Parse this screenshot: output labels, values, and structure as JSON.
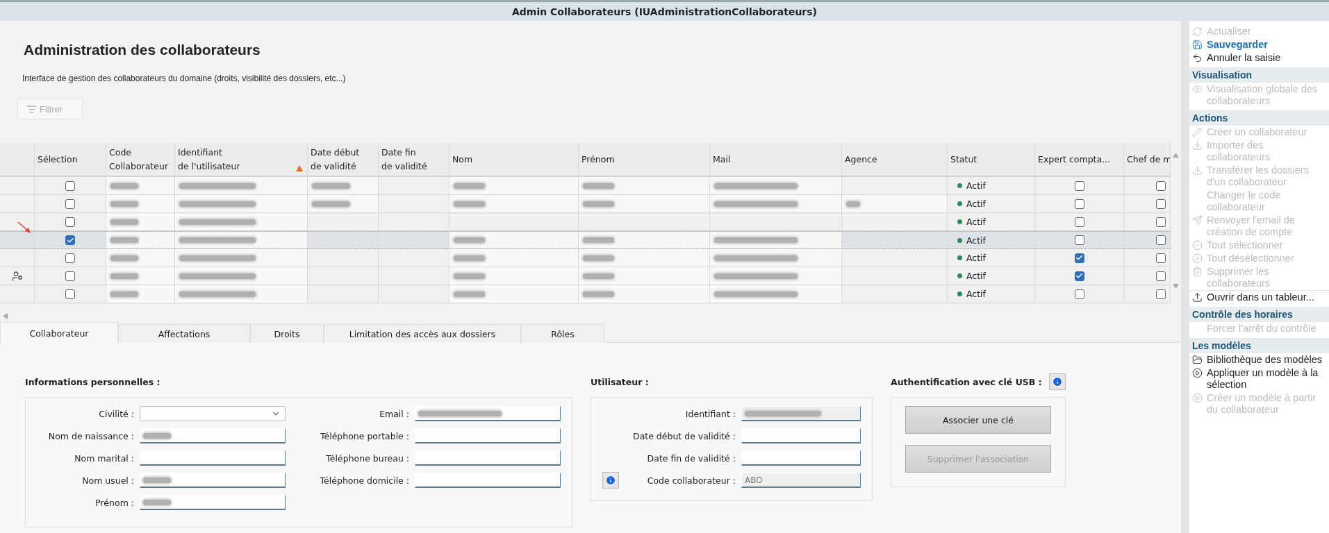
{
  "window": {
    "title": "Admin Collaborateurs (IUAdministrationCollaborateurs)"
  },
  "page": {
    "title": "Administration des collaborateurs",
    "subtitle": "Interface de gestion des collaborateurs du domaine (droits, visibilité des dossiers, etc...)",
    "filter_button": "Filtrer"
  },
  "table": {
    "columns": [
      {
        "kind": "rowhead",
        "sorted": false
      },
      {
        "lines": [
          "Sélection"
        ],
        "kind": "check",
        "sorted": false
      },
      {
        "lines": [
          "Code",
          "Collaborateur"
        ],
        "kind": "text",
        "sorted": false
      },
      {
        "lines": [
          "Identifiant",
          "de l'utilisateur"
        ],
        "kind": "text",
        "sorted": true
      },
      {
        "lines": [
          "Date début",
          "de validité"
        ],
        "kind": "text",
        "sorted": false
      },
      {
        "lines": [
          "Date fin",
          "de validité"
        ],
        "kind": "text",
        "sorted": false
      },
      {
        "lines": [
          "Nom"
        ],
        "kind": "text",
        "sorted": false
      },
      {
        "lines": [
          "Prénom"
        ],
        "kind": "text",
        "sorted": false
      },
      {
        "lines": [
          "Mail"
        ],
        "kind": "text",
        "sorted": false
      },
      {
        "lines": [
          "Agence"
        ],
        "kind": "text",
        "sorted": false
      },
      {
        "lines": [
          "Statut"
        ],
        "kind": "status",
        "sorted": false
      },
      {
        "lines": [
          "Expert compta..."
        ],
        "kind": "check",
        "sorted": false
      },
      {
        "lines": [
          "Chef de m"
        ],
        "kind": "check",
        "sorted": false
      }
    ],
    "rows": [
      {
        "selected": false,
        "user_icon": false,
        "checks": [
          false,
          false,
          false
        ],
        "redacted": [
          true,
          true,
          true,
          false,
          true,
          true,
          true,
          false
        ],
        "status": "Actif"
      },
      {
        "selected": false,
        "user_icon": false,
        "checks": [
          false,
          false,
          false
        ],
        "redacted": [
          true,
          true,
          true,
          false,
          true,
          true,
          true,
          true
        ],
        "status": "Actif"
      },
      {
        "selected": false,
        "user_icon": false,
        "checks": [
          false,
          false,
          false
        ],
        "redacted": [
          true,
          true,
          false,
          false,
          false,
          false,
          false,
          false
        ],
        "status": "Actif"
      },
      {
        "selected": true,
        "user_icon": false,
        "checks": [
          true,
          false,
          false
        ],
        "redacted": [
          true,
          true,
          false,
          false,
          true,
          true,
          true,
          false
        ],
        "status": "Actif"
      },
      {
        "selected": false,
        "user_icon": false,
        "checks": [
          false,
          true,
          false
        ],
        "redacted": [
          true,
          true,
          false,
          false,
          true,
          true,
          true,
          false
        ],
        "status": "Actif"
      },
      {
        "selected": false,
        "user_icon": true,
        "checks": [
          false,
          true,
          false
        ],
        "redacted": [
          true,
          true,
          false,
          false,
          true,
          true,
          true,
          false
        ],
        "status": "Actif"
      },
      {
        "selected": false,
        "user_icon": false,
        "checks": [
          false,
          false,
          false
        ],
        "redacted": [
          true,
          true,
          false,
          false,
          true,
          true,
          true,
          false
        ],
        "status": "Actif"
      }
    ]
  },
  "tabs": [
    {
      "label": "Collaborateur",
      "selected": true
    },
    {
      "label": "Affectations",
      "selected": false
    },
    {
      "label": "Droits",
      "selected": false
    },
    {
      "label": "Limitation des accès aux dossiers",
      "selected": false
    },
    {
      "label": "Rôles",
      "selected": false
    }
  ],
  "personal": {
    "title": "Informations personnelles :",
    "left": [
      {
        "label": "Civilité :",
        "kind": "select",
        "redacted": false
      },
      {
        "label": "Nom de naissance :",
        "kind": "input",
        "redacted": true
      },
      {
        "label": "Nom marital :",
        "kind": "input",
        "redacted": false
      },
      {
        "label": "Nom usuel :",
        "kind": "input",
        "redacted": true
      },
      {
        "label": "Prénom :",
        "kind": "input",
        "redacted": true
      }
    ],
    "right": [
      {
        "label": "Email :",
        "kind": "input",
        "redacted": true
      },
      {
        "label": "Téléphone portable :",
        "kind": "input",
        "redacted": false
      },
      {
        "label": "Téléphone bureau :",
        "kind": "input",
        "redacted": false
      },
      {
        "label": "Téléphone domicile :",
        "kind": "input",
        "redacted": false
      }
    ]
  },
  "user": {
    "title": "Utilisateur :",
    "fields": [
      {
        "label": "Identifiant :",
        "readonly": true,
        "redacted": true,
        "info": false
      },
      {
        "label": "Date début de validité :",
        "readonly": false,
        "redacted": false,
        "info": false
      },
      {
        "label": "Date fin de validité :",
        "readonly": false,
        "redacted": false,
        "info": false
      },
      {
        "label": "Code collaborateur :",
        "readonly": true,
        "redacted": false,
        "value": "ABO",
        "info": true
      }
    ]
  },
  "usb": {
    "title": "Authentification avec clé USB :",
    "buttons": [
      {
        "label": "Associer une clé",
        "disabled": false
      },
      {
        "label": "Supprimer l'association",
        "disabled": true
      }
    ]
  },
  "side_panel": {
    "sections": [
      {
        "items": [
          {
            "label": "Actualiser",
            "disabled": true,
            "primary": false
          },
          {
            "label": "Sauvegarder",
            "disabled": false,
            "primary": true
          },
          {
            "label": "Annuler la saisie",
            "disabled": false,
            "primary": false
          }
        ]
      },
      {
        "title": "Visualisation",
        "items": [
          {
            "label": "Visualisation globale des collaborateurs",
            "disabled": true,
            "primary": false
          }
        ]
      },
      {
        "title": "Actions",
        "items": [
          {
            "label": "Créer un collaborateur",
            "disabled": true,
            "primary": false
          },
          {
            "label": "Importer des collaborateurs",
            "disabled": true,
            "primary": false
          },
          {
            "label": "Transférer les dossiers d'un collaborateur",
            "disabled": true,
            "primary": false
          },
          {
            "label": "Changer le code collaborateur",
            "disabled": true,
            "primary": false
          },
          {
            "label": "Renvoyer l'email de création de compte",
            "disabled": true,
            "primary": false
          },
          {
            "label": "Tout sélectionner",
            "disabled": true,
            "primary": false
          },
          {
            "label": "Tout désélectionner",
            "disabled": true,
            "primary": false
          },
          {
            "label": "Supprimer les collaborateurs",
            "disabled": true,
            "primary": false
          },
          {
            "label": "Ouvrir dans un tableur...",
            "disabled": false,
            "primary": false
          }
        ]
      },
      {
        "title": "Contrôle des horaires",
        "items": [
          {
            "label": "Forcer l'arrêt du contrôle",
            "disabled": true,
            "primary": false
          }
        ]
      },
      {
        "title": "Les modèles",
        "items": [
          {
            "label": "Bibliothèque des modèles",
            "disabled": false,
            "primary": false
          },
          {
            "label": "Appliquer un modèle à la sélection",
            "disabled": false,
            "primary": false
          },
          {
            "label": "Créer un modèle à partir du collaborateur",
            "disabled": true,
            "primary": false
          }
        ]
      }
    ]
  }
}
